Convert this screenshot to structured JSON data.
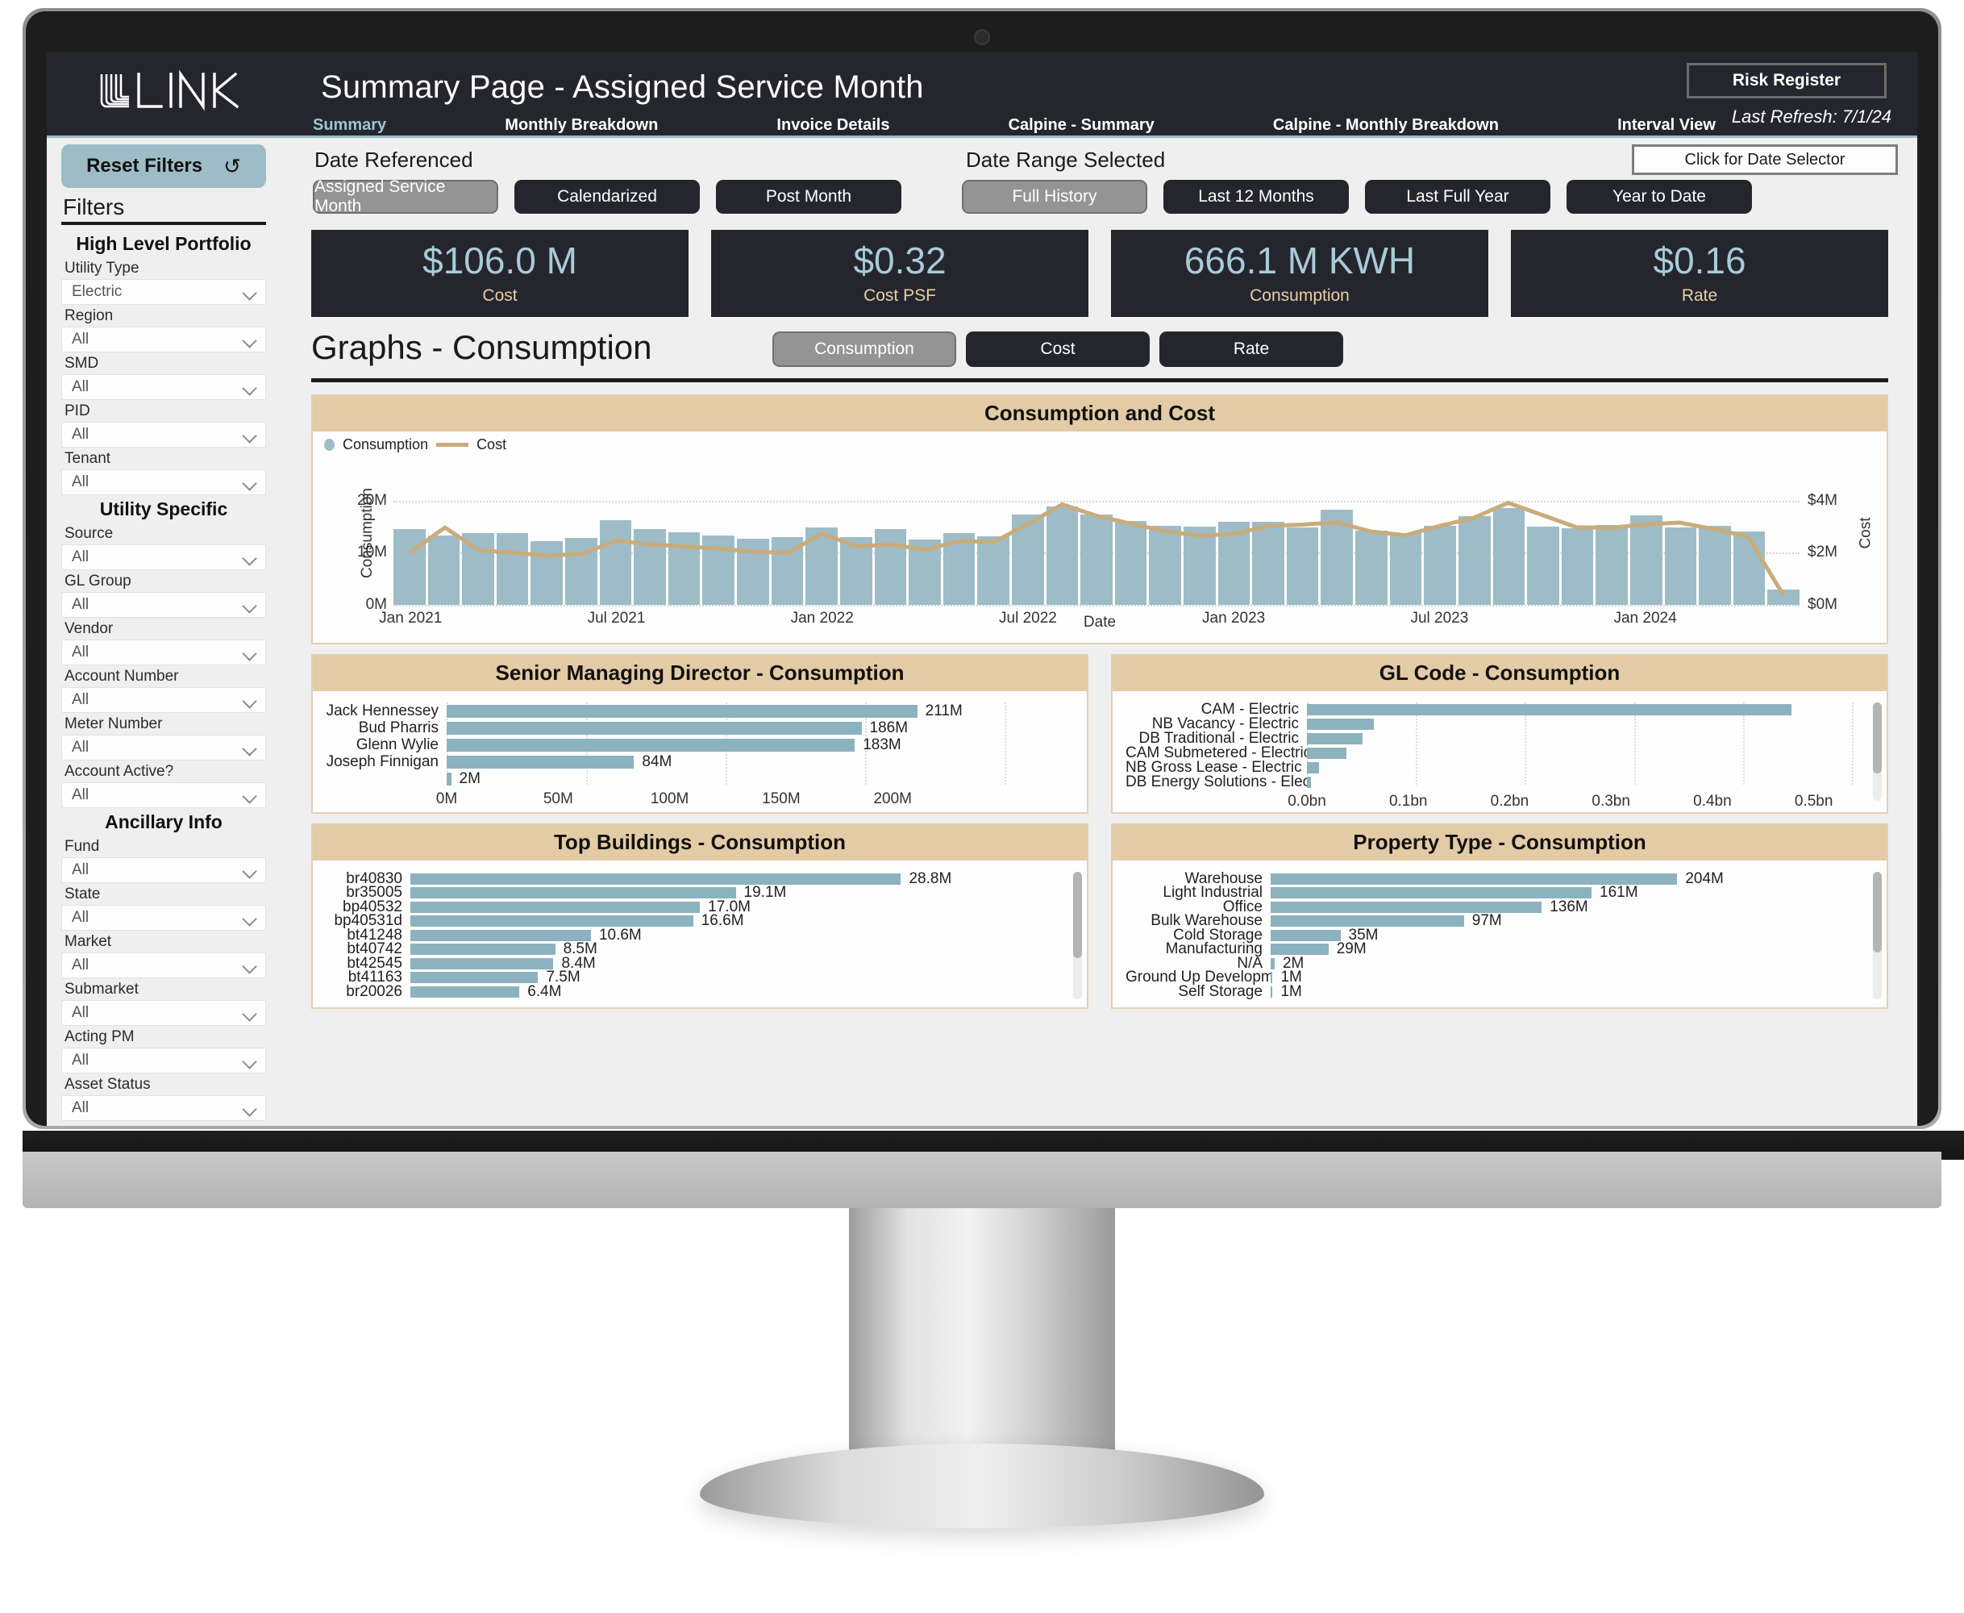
{
  "header": {
    "logo_text": "LINK",
    "title": "Summary Page - Assigned Service Month",
    "risk_register": "Risk Register",
    "last_refresh": "Last Refresh: 7/1/24",
    "tabs": [
      {
        "label": "Summary",
        "active": true
      },
      {
        "label": "Monthly Breakdown",
        "active": false
      },
      {
        "label": "Invoice Details",
        "active": false
      },
      {
        "label": "Calpine - Summary",
        "active": false
      },
      {
        "label": "Calpine - Monthly Breakdown",
        "active": false
      },
      {
        "label": "Interval View",
        "active": false
      }
    ]
  },
  "sidebar": {
    "reset_label": "Reset Filters",
    "reset_icon": "undo-icon",
    "filters_title": "Filters",
    "groups": [
      {
        "title": "High Level Portfolio",
        "filters": [
          {
            "label": "Utility Type",
            "value": "Electric"
          },
          {
            "label": "Region",
            "value": "All"
          },
          {
            "label": "SMD",
            "value": "All"
          },
          {
            "label": "PID",
            "value": "All"
          },
          {
            "label": "Tenant",
            "value": "All"
          }
        ]
      },
      {
        "title": "Utility Specific",
        "filters": [
          {
            "label": "Source",
            "value": "All"
          },
          {
            "label": "GL Group",
            "value": "All"
          },
          {
            "label": "Vendor",
            "value": "All"
          },
          {
            "label": "Account Number",
            "value": "All"
          },
          {
            "label": "Meter Number",
            "value": "All"
          },
          {
            "label": "Account Active?",
            "value": "All"
          }
        ]
      },
      {
        "title": "Ancillary Info",
        "filters": [
          {
            "label": "Fund",
            "value": "All"
          },
          {
            "label": "State",
            "value": "All"
          },
          {
            "label": "Market",
            "value": "All"
          },
          {
            "label": "Submarket",
            "value": "All"
          },
          {
            "label": "Acting PM",
            "value": "All"
          },
          {
            "label": "Asset Status",
            "value": "All"
          }
        ]
      }
    ]
  },
  "controls": {
    "date_referenced_label": "Date Referenced",
    "date_range_label": "Date Range Selected",
    "date_selector_button": "Click for Date Selector",
    "date_referenced_options": [
      {
        "label": "Assigned Service Month",
        "selected": true
      },
      {
        "label": "Calendarized",
        "selected": false
      },
      {
        "label": "Post Month",
        "selected": false
      }
    ],
    "date_range_options": [
      {
        "label": "Full History",
        "selected": true
      },
      {
        "label": "Last 12 Months",
        "selected": false
      },
      {
        "label": "Last Full Year",
        "selected": false
      },
      {
        "label": "Year to Date",
        "selected": false
      }
    ]
  },
  "kpis": [
    {
      "value": "$106.0 M",
      "label": "Cost"
    },
    {
      "value": "$0.32",
      "label": "Cost PSF"
    },
    {
      "value": "666.1 M KWH",
      "label": "Consumption"
    },
    {
      "value": "$0.16",
      "label": "Rate"
    }
  ],
  "graphs": {
    "title": "Graphs - Consumption",
    "metric_toggles": [
      {
        "label": "Consumption",
        "selected": true
      },
      {
        "label": "Cost",
        "selected": false
      },
      {
        "label": "Rate",
        "selected": false
      }
    ]
  },
  "colors": {
    "bar_blue": "#9dbcc7",
    "line_tan": "#c9ac7b",
    "panel_header_tan": "#e3cba6",
    "header_dark": "#25262d",
    "kpi_value": "#a9cbd8",
    "kpi_label": "#e6cfa8"
  },
  "chart_data": [
    {
      "id": "consumption-and-cost",
      "type": "bar",
      "title": "Consumption and Cost",
      "xlabel": "Date",
      "ylabel": "Consumption",
      "y2label": "Cost",
      "legend": [
        "Consumption",
        "Cost"
      ],
      "legend_position": "top-left",
      "grid": true,
      "ylim": [
        0,
        24
      ],
      "yticks": [
        0,
        10,
        20
      ],
      "ytick_labels": [
        "0M",
        "10M",
        "20M"
      ],
      "y2lim": [
        0,
        4.8
      ],
      "y2ticks": [
        0,
        2,
        4
      ],
      "y2tick_labels": [
        "$0M",
        "$2M",
        "$4M"
      ],
      "xtick_labels": [
        "Jan 2021",
        "Jul 2021",
        "Jan 2022",
        "Jul 2022",
        "Jan 2023",
        "Jul 2023",
        "Jan 2024"
      ],
      "xtick_indices": [
        0,
        6,
        12,
        18,
        24,
        30,
        36
      ],
      "categories": [
        "Jan 2021",
        "Feb 2021",
        "Mar 2021",
        "Apr 2021",
        "May 2021",
        "Jun 2021",
        "Jul 2021",
        "Aug 2021",
        "Sep 2021",
        "Oct 2021",
        "Nov 2021",
        "Dec 2021",
        "Jan 2022",
        "Feb 2022",
        "Mar 2022",
        "Apr 2022",
        "May 2022",
        "Jun 2022",
        "Jul 2022",
        "Aug 2022",
        "Sep 2022",
        "Oct 2022",
        "Nov 2022",
        "Dec 2022",
        "Jan 2023",
        "Feb 2023",
        "Mar 2023",
        "Apr 2023",
        "May 2023",
        "Jun 2023",
        "Jul 2023",
        "Aug 2023",
        "Sep 2023",
        "Oct 2023",
        "Nov 2023",
        "Dec 2023",
        "Jan 2024",
        "Feb 2024",
        "Mar 2024",
        "Apr 2024",
        "May 2024"
      ],
      "series": [
        {
          "name": "Consumption",
          "unit": "kWh",
          "kind": "bar",
          "values": [
            14.6,
            13.4,
            13.8,
            13.8,
            12.2,
            12.8,
            16.2,
            14.6,
            13.9,
            13.3,
            12.7,
            13.0,
            14.8,
            13.0,
            14.5,
            12.6,
            13.8,
            13.2,
            17.3,
            18.9,
            17.4,
            16.1,
            15.2,
            15.1,
            15.9,
            15.9,
            14.8,
            18.3,
            14.3,
            13.8,
            15.2,
            17.0,
            18.6,
            15.1,
            14.7,
            15.3,
            17.2,
            14.9,
            15.2,
            14.1,
            3.0
          ]
        },
        {
          "name": "Cost",
          "unit": "USD",
          "kind": "line",
          "values": [
            2.02,
            2.97,
            2.09,
            2.0,
            1.89,
            1.96,
            2.47,
            2.32,
            2.24,
            2.16,
            2.04,
            2.0,
            2.74,
            2.24,
            2.32,
            2.12,
            2.45,
            2.41,
            3.1,
            3.86,
            3.42,
            3.12,
            2.83,
            2.66,
            2.72,
            3.03,
            3.08,
            3.17,
            2.82,
            2.67,
            3.03,
            3.34,
            3.92,
            3.45,
            2.98,
            2.96,
            3.09,
            3.16,
            2.91,
            2.62,
            0.44
          ]
        }
      ]
    },
    {
      "id": "smd-consumption",
      "type": "bar",
      "orientation": "horizontal",
      "title": "Senior Managing Director - Consumption",
      "xlabel": "",
      "ylabel": "",
      "xlim": [
        0,
        225
      ],
      "xticks": [
        0,
        50,
        100,
        150,
        200
      ],
      "xtick_labels": [
        "0M",
        "50M",
        "100M",
        "150M",
        "200M"
      ],
      "categories": [
        "Jack Hennessey",
        "Bud Pharris",
        "Glenn Wylie",
        "Joseph Finnigan",
        ""
      ],
      "values": [
        211,
        186,
        183,
        84,
        2
      ],
      "value_labels": [
        "211M",
        "186M",
        "183M",
        "84M",
        "2M"
      ]
    },
    {
      "id": "gl-code-consumption",
      "type": "bar",
      "orientation": "horizontal",
      "title": "GL Code - Consumption",
      "xlabel": "",
      "ylabel": "",
      "xlim": [
        0,
        0.52
      ],
      "xticks": [
        0.0,
        0.1,
        0.2,
        0.3,
        0.4,
        0.5
      ],
      "xtick_labels": [
        "0.0bn",
        "0.1bn",
        "0.2bn",
        "0.3bn",
        "0.4bn",
        "0.5bn"
      ],
      "categories": [
        "CAM - Electric",
        "NB Vacancy - Electric",
        "DB Traditional - Electric",
        "DB Traditional - Electric2",
        "CAM Submetered - Electric",
        "NB Gross Lease - Electric",
        "DB Energy Solutions - Electric"
      ],
      "display_categories": [
        "CAM - Electric",
        "NB Vacancy - Electric",
        "DB Traditional - Electric",
        "CAM Submetered - Electric",
        "NB Gross Lease - Electric",
        "DB Energy Solutions - Electric"
      ],
      "values": [
        0.478,
        0.066,
        0.055,
        0.039,
        0.012,
        0.004
      ],
      "scrollable": true
    },
    {
      "id": "top-buildings-consumption",
      "type": "bar",
      "orientation": "horizontal",
      "title": "Top Buildings - Consumption",
      "xlabel": "",
      "ylabel": "",
      "xlim": [
        0,
        33.5
      ],
      "categories": [
        "br40830",
        "br35005",
        "bp40532",
        "bp40531d",
        "bt41248",
        "bt40742",
        "bt42545",
        "bt41163",
        "br20026"
      ],
      "values": [
        28.8,
        19.1,
        17.0,
        16.6,
        10.6,
        8.5,
        8.4,
        7.5,
        6.4
      ],
      "value_labels": [
        "28.8M",
        "19.1M",
        "17.0M",
        "16.6M",
        "10.6M",
        "8.5M",
        "8.4M",
        "7.5M",
        "6.4M"
      ],
      "scrollable": true
    },
    {
      "id": "property-type-consumption",
      "type": "bar",
      "orientation": "horizontal",
      "title": "Property Type - Consumption",
      "xlabel": "",
      "ylabel": "",
      "xlim": [
        0,
        236
      ],
      "categories": [
        "Warehouse",
        "Light Industrial",
        "Office",
        "Bulk Warehouse",
        "Cold Storage",
        "Manufacturing",
        "N/A",
        "Ground Up Development",
        "Self Storage"
      ],
      "values": [
        204,
        161,
        136,
        97,
        35,
        29,
        2,
        1,
        1
      ],
      "value_labels": [
        "204M",
        "161M",
        "136M",
        "97M",
        "35M",
        "29M",
        "2M",
        "1M",
        "1M"
      ],
      "scrollable": true
    }
  ]
}
